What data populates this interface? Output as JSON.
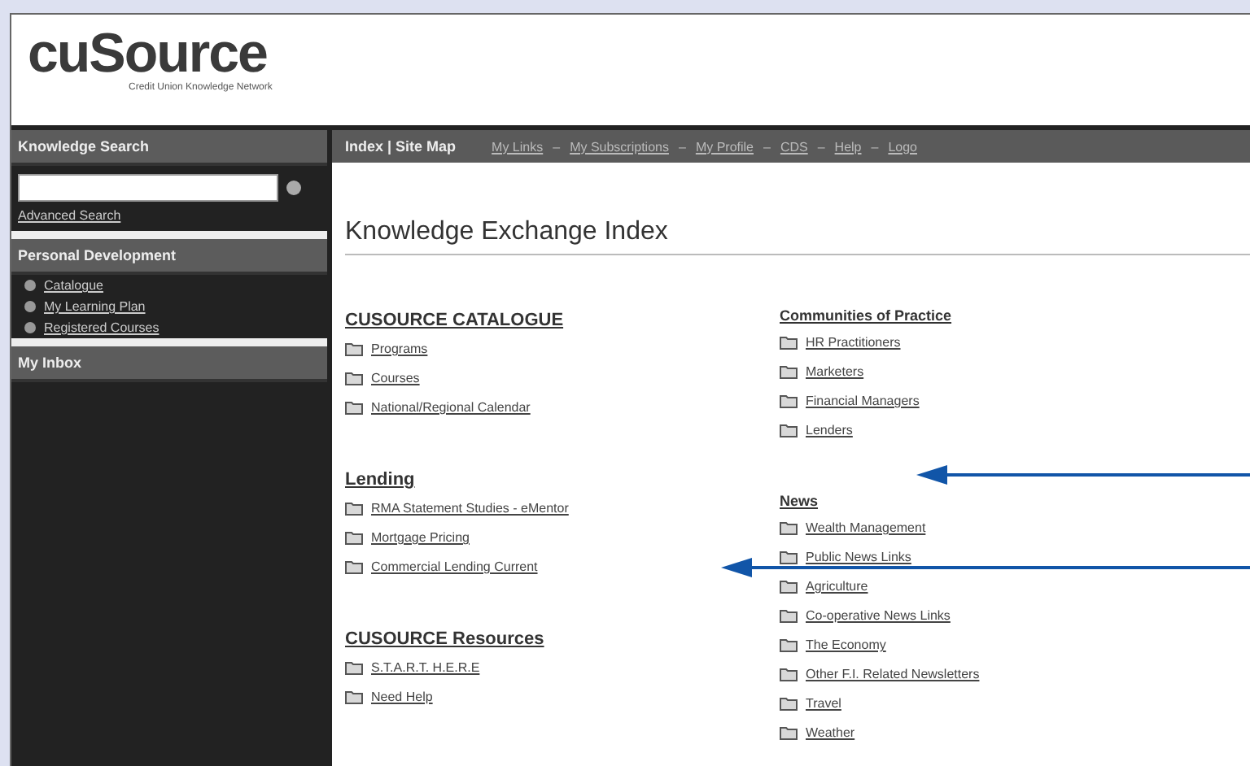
{
  "logo": {
    "name": "cuSource",
    "tagline": "Credit Union Knowledge Network"
  },
  "sidebar": {
    "search": {
      "title": "Knowledge Search",
      "advanced_link": "Advanced Search"
    },
    "sections": [
      {
        "title": "Personal Development",
        "items": [
          "Catalogue",
          "My Learning Plan",
          "Registered Courses"
        ]
      },
      {
        "title": "My Inbox"
      }
    ]
  },
  "top_bar": {
    "index_links": "Index | Site Map",
    "nav_links": [
      "My Links",
      "My Subscriptions",
      "My Profile",
      "CDS",
      "Help",
      "Logo"
    ],
    "separator": "–"
  },
  "page_title": "Knowledge Exchange Index",
  "columns": [
    [
      {
        "title": "CUSOURCE CATALOGUE",
        "items": [
          "Programs",
          "Courses",
          "National/Regional Calendar"
        ]
      },
      {
        "title": "Lending",
        "items": [
          "RMA Statement Studies - eMentor",
          "Mortgage Pricing",
          "Commercial Lending Current"
        ]
      },
      {
        "title": "CUSOURCE Resources",
        "items": [
          "S.T.A.R.T. H.E.R.E",
          "Need Help"
        ]
      }
    ],
    [
      {
        "title": "Communities of Practice",
        "items": [
          "HR Practitioners",
          "Marketers",
          "Financial Managers",
          "Lenders"
        ]
      },
      {
        "title": "News",
        "items": [
          "Wealth Management",
          "Public News Links",
          "Agriculture",
          "Co-operative News Links",
          "The Economy",
          "Other F.I. Related Newsletters",
          "Travel",
          "Weather"
        ]
      }
    ]
  ]
}
